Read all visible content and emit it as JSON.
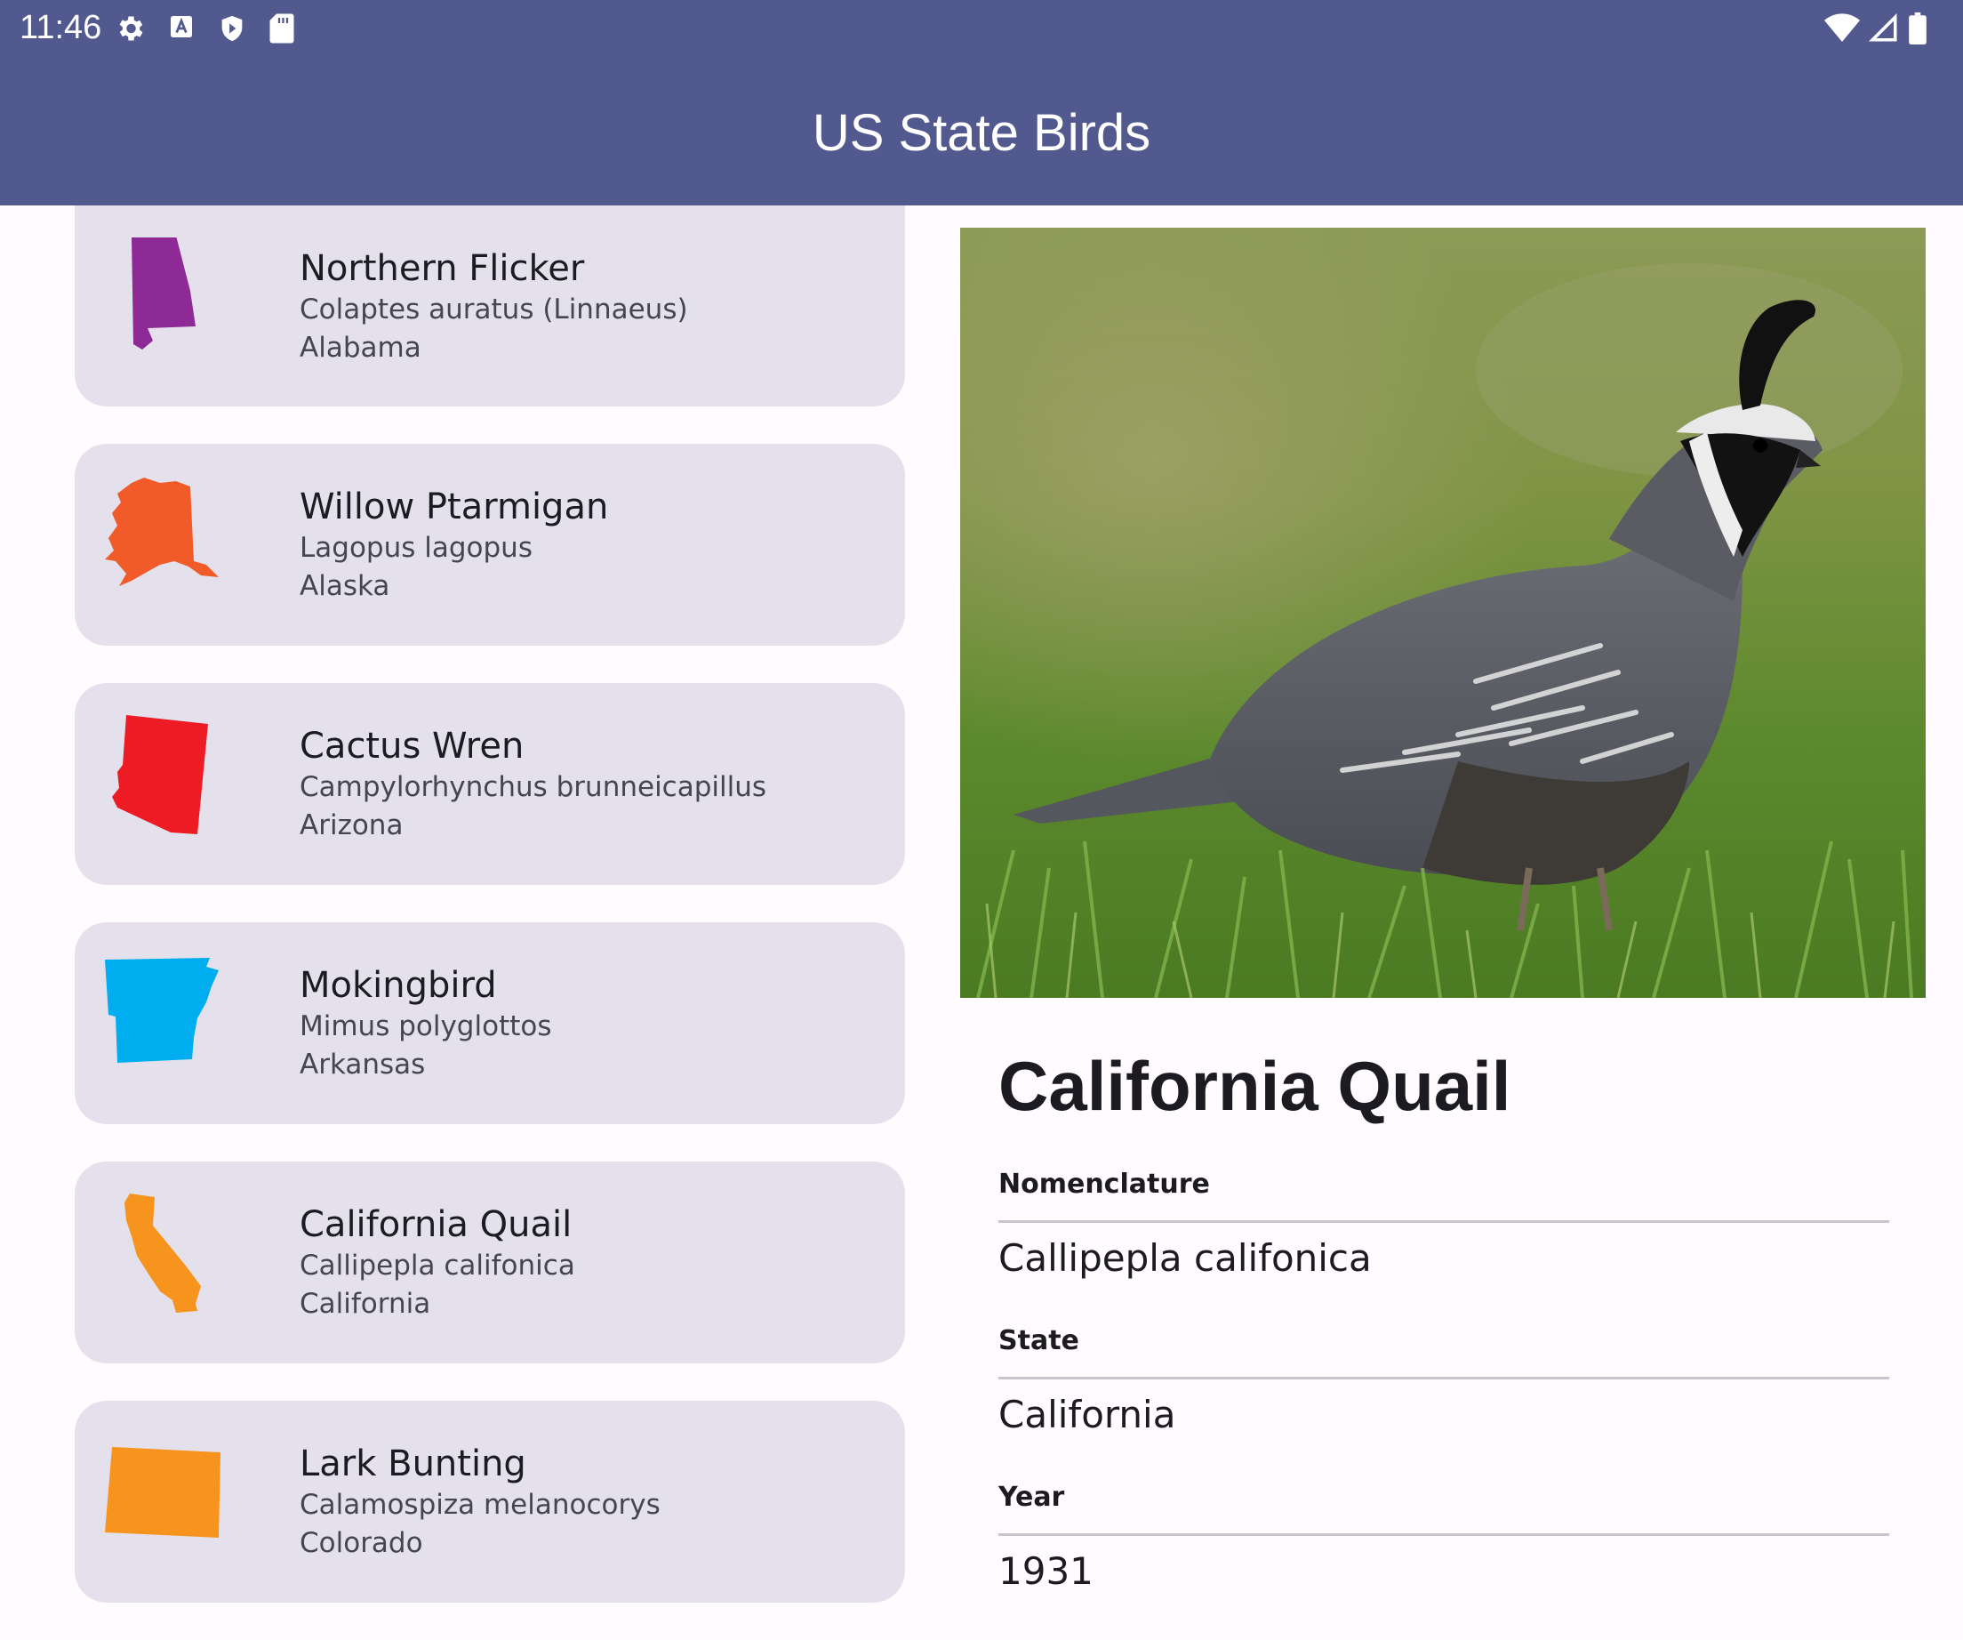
{
  "status_bar": {
    "time": "11:46",
    "left_icons": [
      "gear-icon",
      "a-icon",
      "shield-play-icon",
      "sd-card-icon"
    ],
    "right_icons": [
      "wifi-icon",
      "cell-signal-icon",
      "battery-icon"
    ]
  },
  "app_bar": {
    "title": "US State Birds"
  },
  "birds": [
    {
      "name": "Northern Flicker",
      "scientific": "Colaptes auratus (Linnaeus)",
      "state": "Alabama",
      "color": "#8E2A96"
    },
    {
      "name": "Willow Ptarmigan",
      "scientific": "Lagopus lagopus",
      "state": "Alaska",
      "color": "#F15A29"
    },
    {
      "name": "Cactus Wren",
      "scientific": "Campylorhynchus brunneicapillus",
      "state": "Arizona",
      "color": "#ED1C24"
    },
    {
      "name": "Mokingbird",
      "scientific": "Mimus polyglottos",
      "state": "Arkansas",
      "color": "#00AEEF"
    },
    {
      "name": "California Quail",
      "scientific": "Callipepla califonica",
      "state": "California",
      "color": "#F7941D"
    },
    {
      "name": "Lark Bunting",
      "scientific": "Calamospiza melanocorys",
      "state": "Colorado",
      "color": "#F7941D"
    }
  ],
  "detail": {
    "title": "California Quail",
    "nomenclature_label": "Nomenclature",
    "nomenclature_value": "Callipepla califonica",
    "state_label": "State",
    "state_value": "California",
    "year_label": "Year",
    "year_value": "1931"
  },
  "colors": {
    "primary": "#52598F",
    "card_bg": "#E4E1EC",
    "background": "#FFFBFE"
  }
}
